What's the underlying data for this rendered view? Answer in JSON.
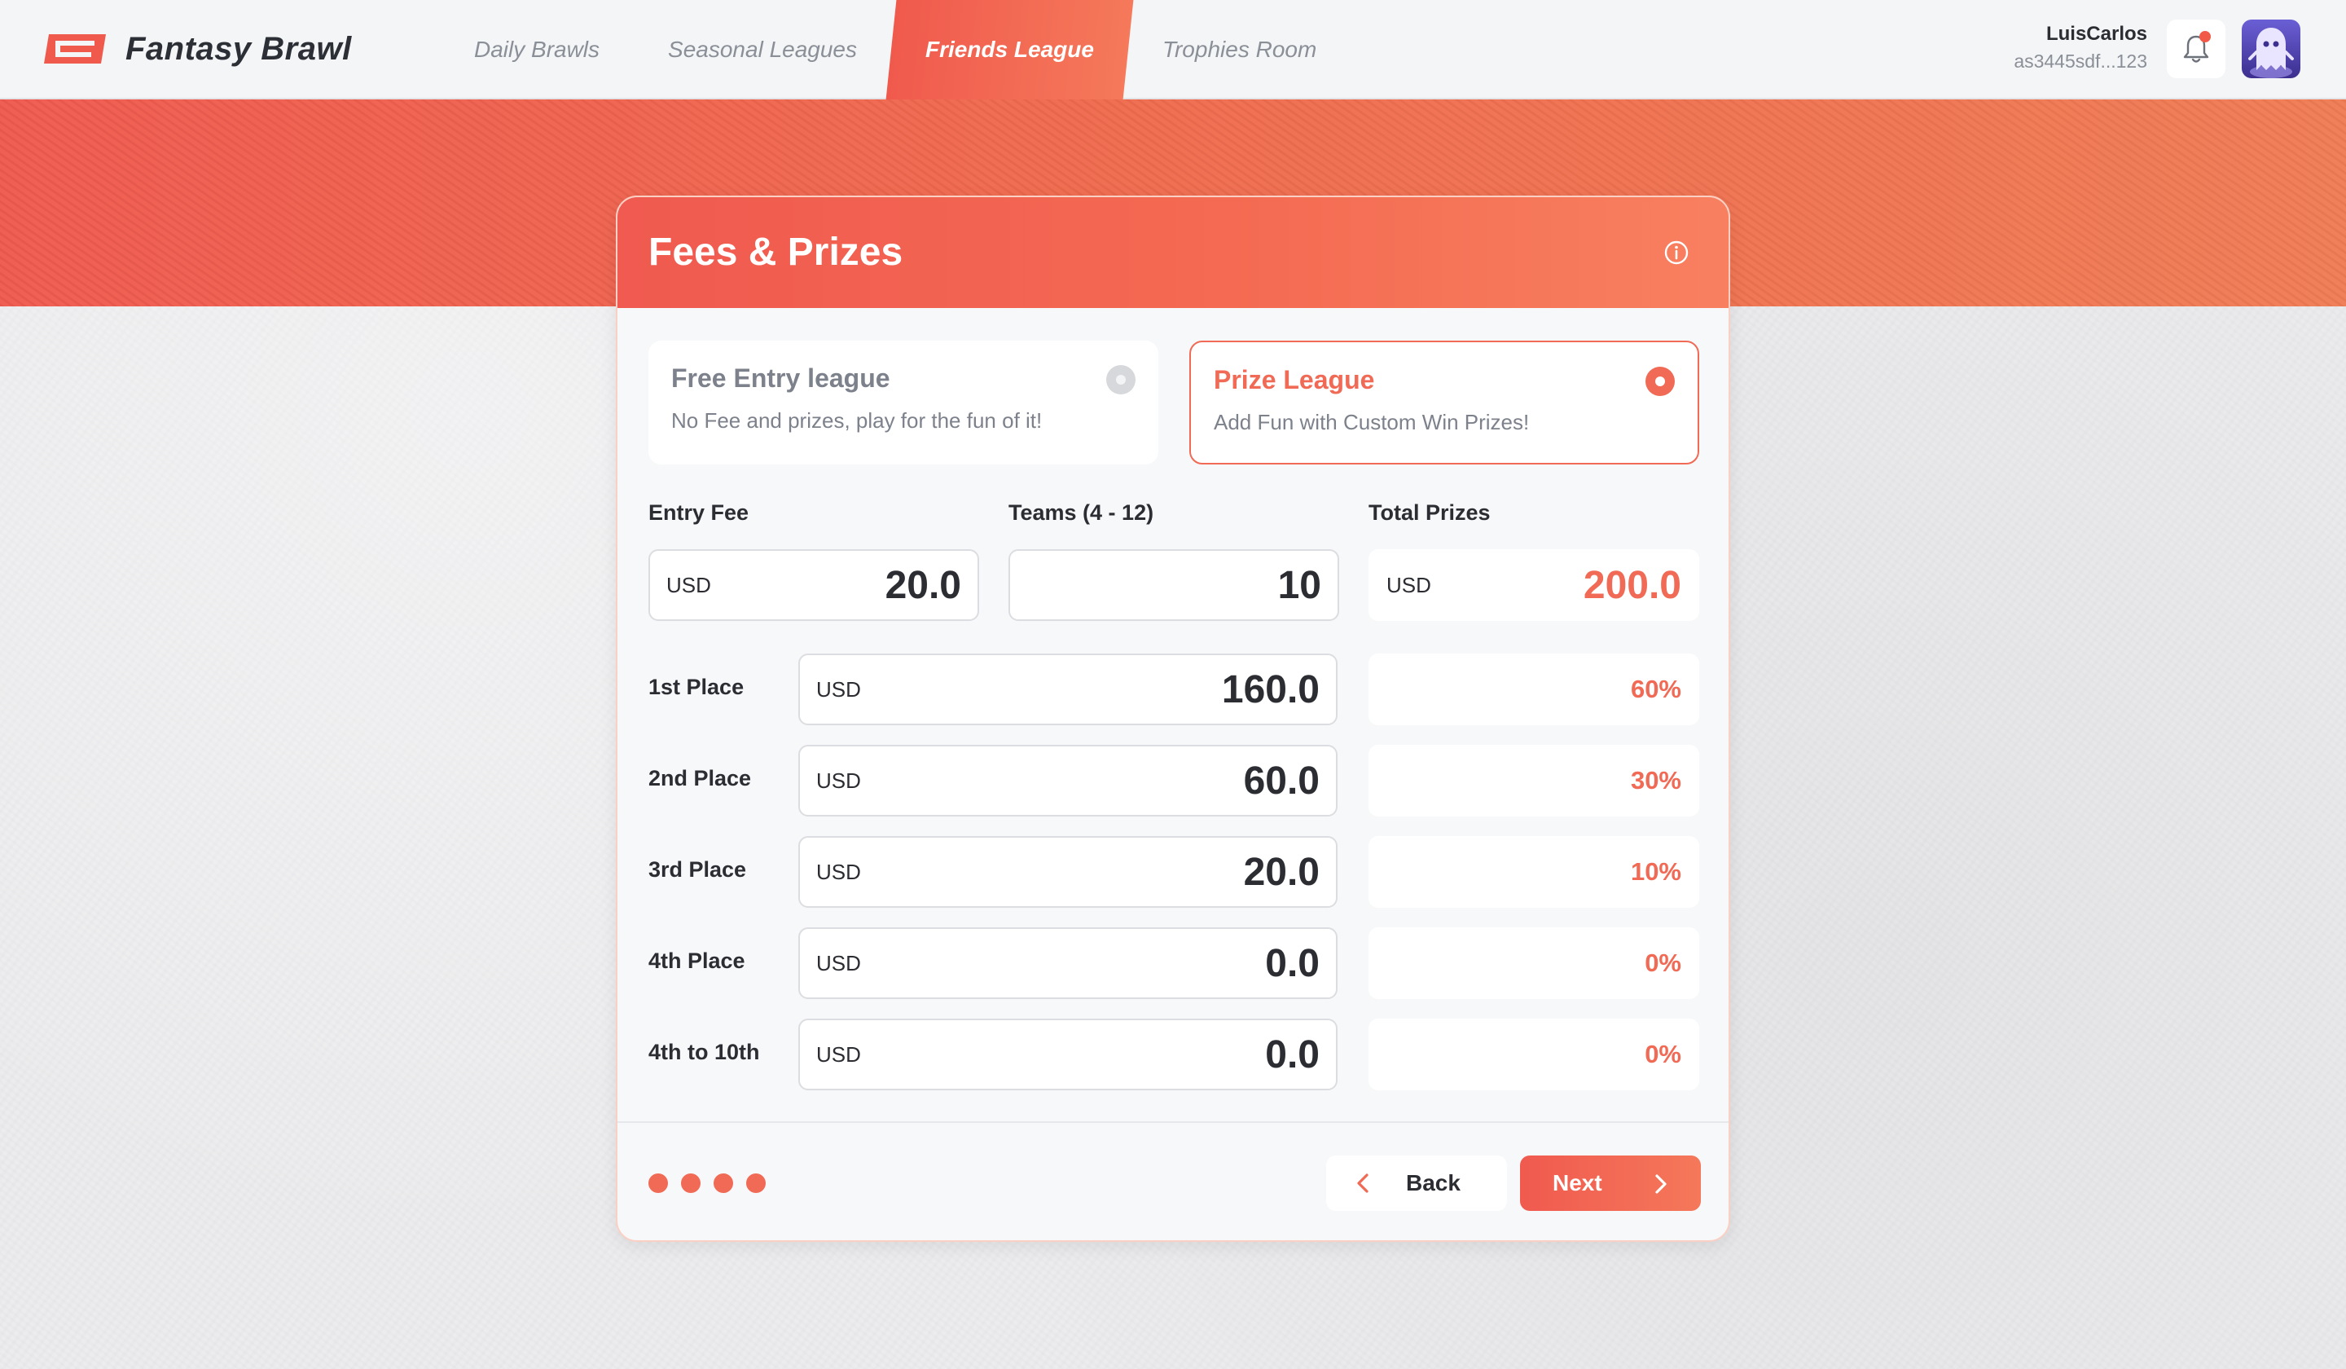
{
  "app": {
    "name": "Fantasy Brawl"
  },
  "nav": {
    "items": [
      {
        "label": "Daily Brawls",
        "active": false
      },
      {
        "label": "Seasonal Leagues",
        "active": false
      },
      {
        "label": "Friends League",
        "active": true
      },
      {
        "label": "Trophies Room",
        "active": false
      }
    ]
  },
  "user": {
    "name": "LuisCarlos",
    "id": "as3445sdf...123",
    "has_notification": true
  },
  "colors": {
    "accent": "#f06a55",
    "accent_dark": "#f05a4f"
  },
  "card": {
    "title": "Fees & Prizes",
    "options": {
      "free": {
        "title": "Free Entry league",
        "subtitle": "No Fee and prizes, play for the fun of it!",
        "selected": false
      },
      "prize": {
        "title": "Prize League",
        "subtitle": "Add Fun with Custom Win Prizes!",
        "selected": true
      }
    },
    "entry_fee": {
      "label": "Entry Fee",
      "currency": "USD",
      "value": "20.0"
    },
    "teams": {
      "label": "Teams (4 - 12)",
      "value": "10"
    },
    "total_prizes": {
      "label": "Total Prizes",
      "currency": "USD",
      "value": "200.0"
    },
    "places": [
      {
        "label": "1st Place",
        "currency": "USD",
        "amount": "160.0",
        "percent": "60%"
      },
      {
        "label": "2nd Place",
        "currency": "USD",
        "amount": "60.0",
        "percent": "30%"
      },
      {
        "label": "3rd Place",
        "currency": "USD",
        "amount": "20.0",
        "percent": "10%"
      },
      {
        "label": "4th Place",
        "currency": "USD",
        "amount": "0.0",
        "percent": "0%"
      },
      {
        "label": "4th to 10th",
        "currency": "USD",
        "amount": "0.0",
        "percent": "0%"
      }
    ],
    "steps": {
      "total": 4
    },
    "back_label": "Back",
    "next_label": "Next"
  }
}
